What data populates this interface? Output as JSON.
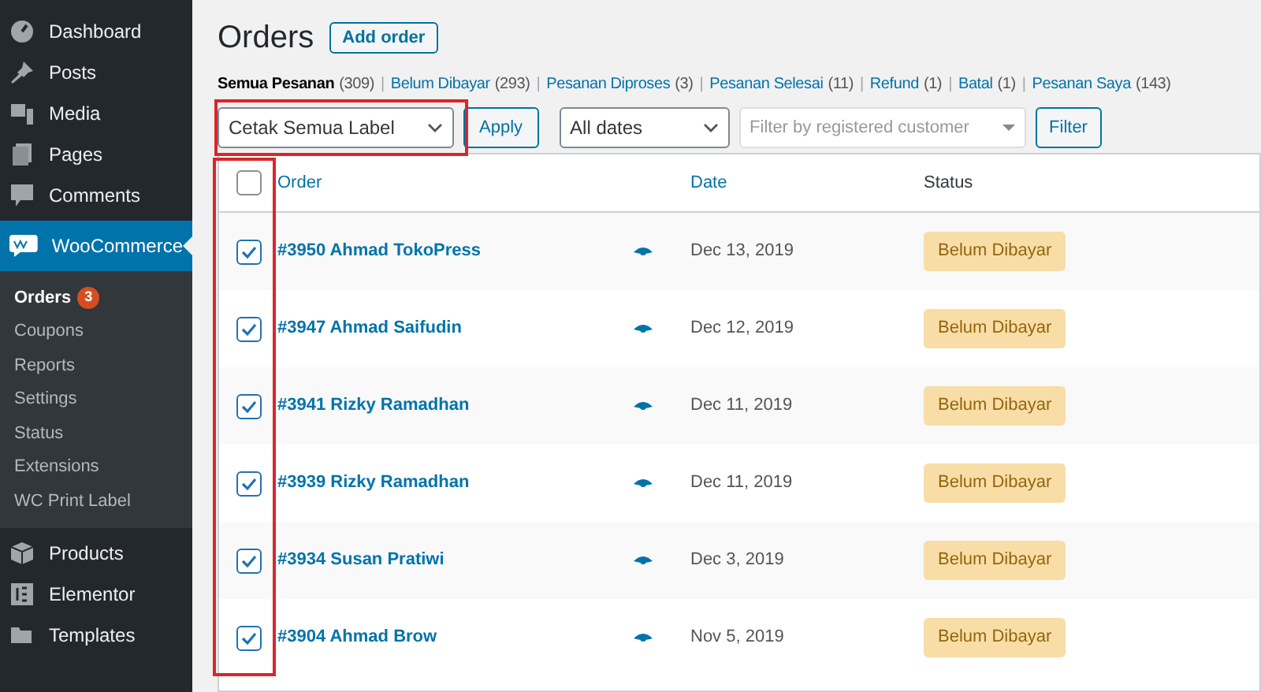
{
  "sidebar": {
    "items": [
      {
        "label": "Dashboard",
        "kind": "gauge",
        "selected": false
      },
      {
        "label": "Posts",
        "kind": "pin",
        "selected": false
      },
      {
        "label": "Media",
        "kind": "media",
        "selected": false
      },
      {
        "label": "Pages",
        "kind": "pages",
        "selected": false
      },
      {
        "label": "Comments",
        "kind": "comment",
        "selected": false
      },
      {
        "label": "WooCommerce",
        "kind": "woo",
        "selected": true,
        "children": [
          {
            "label": "Orders",
            "selected": true,
            "badge": "3"
          },
          {
            "label": "Coupons",
            "selected": false
          },
          {
            "label": "Reports",
            "selected": false
          },
          {
            "label": "Settings",
            "selected": false
          },
          {
            "label": "Status",
            "selected": false
          },
          {
            "label": "Extensions",
            "selected": false
          },
          {
            "label": "WC Print Label",
            "selected": false
          }
        ]
      },
      {
        "label": "Products",
        "kind": "box",
        "selected": false
      },
      {
        "label": "Elementor",
        "kind": "elementor",
        "selected": false
      },
      {
        "label": "Templates",
        "kind": "folder",
        "selected": false
      }
    ]
  },
  "page": {
    "title": "Orders",
    "add_button": "Add order"
  },
  "views": [
    {
      "label": "Semua Pesanan",
      "count": "(309)",
      "selected": true
    },
    {
      "separator": "|",
      "label": "Belum Dibayar",
      "count": "(293)",
      "selected": false
    },
    {
      "separator": "|",
      "label": "Pesanan Diproses",
      "count": "(3)",
      "selected": false
    },
    {
      "separator": "|",
      "label": "Pesanan Selesai",
      "count": "(11)",
      "selected": false
    },
    {
      "separator": "|",
      "label": "Refund",
      "count": "(1)",
      "selected": false
    },
    {
      "separator": "|",
      "label": "Batal",
      "count": "(1)",
      "selected": false
    },
    {
      "separator": "|",
      "label": "Pesanan Saya",
      "count": "(143)",
      "selected": false
    }
  ],
  "toolbar": {
    "bulk_action": "Cetak Semua Label",
    "apply": "Apply",
    "dates": "All dates",
    "customer_placeholder": "Filter by registered customer",
    "filter": "Filter"
  },
  "table": {
    "select_all_checked": false,
    "columns": [
      "Order",
      "Date",
      "Status"
    ],
    "rows": [
      {
        "order": "#3950 Ahmad TokoPress",
        "date": "Dec 13, 2019",
        "status": "Belum Dibayar",
        "checked": true
      },
      {
        "order": "#3947 Ahmad Saifudin",
        "date": "Dec 12, 2019",
        "status": "Belum Dibayar",
        "checked": true
      },
      {
        "order": "#3941 Rizky Ramadhan",
        "date": "Dec 11, 2019",
        "status": "Belum Dibayar",
        "checked": true
      },
      {
        "order": "#3939 Rizky Ramadhan",
        "date": "Dec 11, 2019",
        "status": "Belum Dibayar",
        "checked": true
      },
      {
        "order": "#3934 Susan Pratiwi",
        "date": "Dec 3, 2019",
        "status": "Belum Dibayar",
        "checked": true
      },
      {
        "order": "#3904 Ahmad Brow",
        "date": "Nov 5, 2019",
        "status": "Belum Dibayar",
        "checked": true
      }
    ]
  }
}
